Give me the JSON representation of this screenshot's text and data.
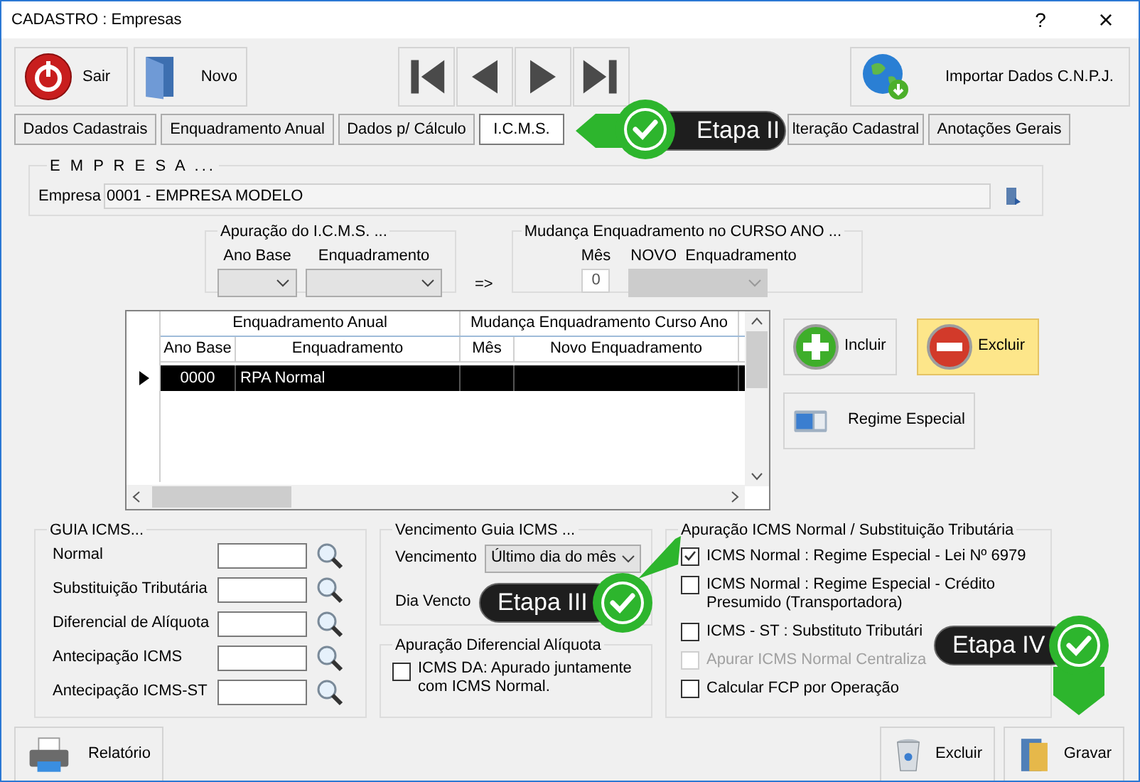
{
  "window": {
    "title": "CADASTRO : Empresas",
    "help": "?",
    "close": "×"
  },
  "toolbar": [
    {
      "label": "Sair",
      "kind": "power"
    },
    {
      "label": "Novo",
      "kind": "new"
    },
    {
      "label": "Importar Dados C.N.P.J.",
      "kind": "globe"
    }
  ],
  "tabs": [
    {
      "label": "Dados Cadastrais",
      "selected": false
    },
    {
      "label": "Enquadramento Anual",
      "selected": false
    },
    {
      "label": "Dados p/ Cálculo",
      "selected": false
    },
    {
      "label": "I.C.M.S.",
      "selected": true
    },
    {
      "label": "lteração Cadastral",
      "selected": false
    },
    {
      "label": "Anotações Gerais",
      "selected": false
    }
  ],
  "empresa": {
    "legend": "E M P R E S A ...",
    "label": "Empresa",
    "value": "0001 - EMPRESA MODELO"
  },
  "apuracao": {
    "legend": "Apuração do  I.C.M.S.  ...",
    "ano_base_label": "Ano Base",
    "enquadramento_label": "Enquadramento"
  },
  "arrow": "=>",
  "mudanca": {
    "legend": "Mudança  Enquadramento no  CURSO  ANO ...",
    "mes_label": "Mês",
    "mes_value": "0",
    "novo_label": "NOVO  Enquadramento"
  },
  "grid": {
    "group_headers": [
      "Enquadramento Anual",
      "Mudança Enquadramento Curso Ano"
    ],
    "columns": [
      "Ano Base",
      "Enquadramento",
      "Mês",
      "Novo Enquadramento"
    ],
    "rows": [
      {
        "cells": [
          "0000",
          "RPA Normal"
        ],
        "selected": true
      }
    ]
  },
  "side_buttons": [
    {
      "label": "Incluir",
      "kind": "add",
      "highlighted": false
    },
    {
      "label": "Excluir",
      "kind": "remove",
      "highlighted": true
    },
    {
      "label": "Regime Especial",
      "kind": "keypad",
      "highlighted": false
    }
  ],
  "guia": {
    "legend": "GUIA ICMS...",
    "fields": [
      "Normal",
      "Substituição Tributária",
      "Diferencial de Alíquota",
      "Antecipação ICMS",
      "Antecipação ICMS-ST"
    ]
  },
  "vencimento": {
    "legend": "Vencimento Guia ICMS ...",
    "label": "Vencimento",
    "value": "Último dia do mês",
    "dia_label": "Dia Vencto"
  },
  "diferencial": {
    "legend": "Apuração Diferencial Alíquota",
    "option": {
      "label": "ICMS DA: Apurado juntamente com ICMS Normal.",
      "checked": false
    }
  },
  "apuracao_normal": {
    "legend": "Apuração  ICMS Normal / Substituição Tributária",
    "options": [
      {
        "label": "ICMS Normal : Regime Especial - Lei Nº 6979",
        "checked": true,
        "disabled": false
      },
      {
        "label": "ICMS Normal : Regime Especial - Crédito Presumido (Transportadora)",
        "checked": false,
        "disabled": false
      },
      {
        "label": "ICMS - ST : Substituto Tributári",
        "checked": false,
        "disabled": false
      },
      {
        "label": "Apurar ICMS Normal Centraliza",
        "checked": false,
        "disabled": true
      },
      {
        "label": "Calcular FCP por Operação",
        "checked": false,
        "disabled": false
      }
    ]
  },
  "footer": [
    {
      "label": "Relatório",
      "kind": "print"
    },
    {
      "label": "Excluir",
      "kind": "trash"
    },
    {
      "label": "Gravar",
      "kind": "save"
    }
  ],
  "callouts": [
    {
      "label": "Etapa II"
    },
    {
      "label": "Etapa III"
    },
    {
      "label": "Etapa IV"
    }
  ]
}
